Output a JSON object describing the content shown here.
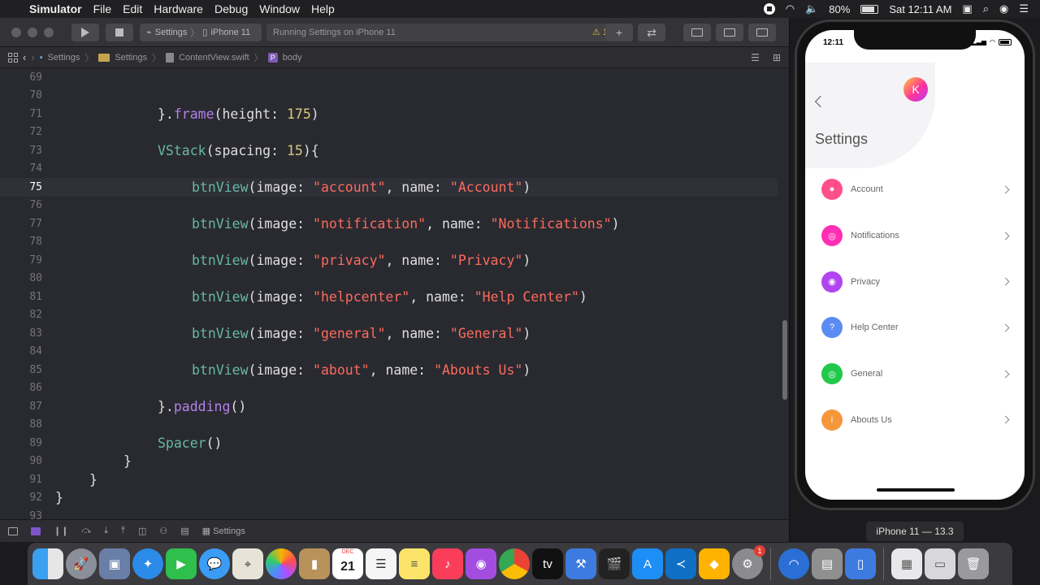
{
  "menubar": {
    "app_name": "Simulator",
    "items": [
      "File",
      "Edit",
      "Hardware",
      "Debug",
      "Window",
      "Help"
    ],
    "battery": "80%",
    "clock": "Sat 12:11 AM"
  },
  "toolbar": {
    "scheme_project": "Settings",
    "scheme_device": "iPhone 11",
    "status_text": "Running Settings on iPhone 11",
    "warning_count": "1"
  },
  "jumpbar": {
    "crumbs": [
      "Settings",
      "Settings",
      "ContentView.swift"
    ],
    "symbol_badge": "P",
    "symbol": "body"
  },
  "editor": {
    "current_line": 75,
    "lines": [
      {
        "n": "69"
      },
      {
        "n": "70"
      },
      {
        "n": "71"
      },
      {
        "n": "72"
      },
      {
        "n": "73"
      },
      {
        "n": "74"
      },
      {
        "n": "75"
      },
      {
        "n": "76"
      },
      {
        "n": "77"
      },
      {
        "n": "78"
      },
      {
        "n": "79"
      },
      {
        "n": "80"
      },
      {
        "n": "81"
      },
      {
        "n": "82"
      },
      {
        "n": "83"
      },
      {
        "n": "84"
      },
      {
        "n": "85"
      },
      {
        "n": "86"
      },
      {
        "n": "87"
      },
      {
        "n": "88"
      },
      {
        "n": "89"
      },
      {
        "n": "90"
      },
      {
        "n": "91"
      },
      {
        "n": "92"
      },
      {
        "n": "93"
      }
    ],
    "code": {
      "l71_a": "}.",
      "l71_b": "frame",
      "l71_c": "(height: ",
      "l71_d": "175",
      "l71_e": ")",
      "l73_a": "VStack",
      "l73_b": "(spacing: ",
      "l73_c": "15",
      "l73_d": "){",
      "btn_fn": "btnView",
      "btn_open": "(image: ",
      "btn_name": ", name: ",
      "btn_close": ")",
      "l75_img": "\"account\"",
      "l75_name": "\"Account\"",
      "l77_img": "\"notification\"",
      "l77_name": "\"Notifications\"",
      "l79_img": "\"privacy\"",
      "l79_name": "\"Privacy\"",
      "l81_img": "\"helpcenter\"",
      "l81_name": "\"Help Center\"",
      "l83_img": "\"general\"",
      "l83_name": "\"General\"",
      "l85_img": "\"about\"",
      "l85_name": "\"Abouts Us\"",
      "l87_a": "}.",
      "l87_b": "padding",
      "l87_c": "()",
      "l89_a": "Spacer",
      "l89_b": "()",
      "brace": "}"
    }
  },
  "debugbar": {
    "target": "Settings"
  },
  "simulator": {
    "device_label": "iPhone 11 — 13.3",
    "time": "12:11",
    "avatar_letter": "K",
    "title": "Settings",
    "menu": [
      {
        "label": "Account",
        "icon": "account-icon",
        "color": "#ff4f8b"
      },
      {
        "label": "Notifications",
        "icon": "notification-icon",
        "color": "#ff2fb3"
      },
      {
        "label": "Privacy",
        "icon": "privacy-icon",
        "color": "#b044f0"
      },
      {
        "label": "Help Center",
        "icon": "help-center-icon",
        "color": "#5a8cf2"
      },
      {
        "label": "General",
        "icon": "general-icon",
        "color": "#22c84a"
      },
      {
        "label": "Abouts Us",
        "icon": "about-icon",
        "color": "#f5963a"
      }
    ]
  },
  "dock": {
    "calendar_month": "DEC",
    "calendar_day": "21",
    "appstore_badge": "1"
  }
}
